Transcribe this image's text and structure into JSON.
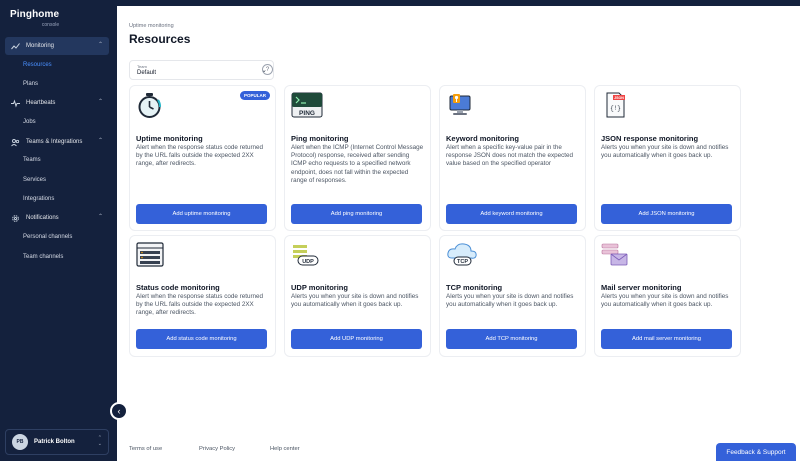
{
  "brand": {
    "name": "Pinghome",
    "sub": "console"
  },
  "sidebar": {
    "groups": [
      {
        "label": "Monitoring",
        "icon": "chart-icon"
      },
      {
        "label": "Heartbeats",
        "icon": "heartbeat-icon"
      },
      {
        "label": "Teams & Integrations",
        "icon": "team-icon"
      },
      {
        "label": "Notifications",
        "icon": "gear-icon"
      }
    ],
    "items": {
      "resources": "Resources",
      "plans": "Plans",
      "jobs": "Jobs",
      "teams": "Teams",
      "services": "Services",
      "integrations": "Integrations",
      "personal_channels": "Personal channels",
      "team_channels": "Team channels"
    }
  },
  "user": {
    "initials": "PB",
    "name": "Patrick Bolton"
  },
  "header": {
    "breadcrumb": "Uptime monitoring",
    "title": "Resources"
  },
  "team_select": {
    "label": "Team",
    "value": "Default"
  },
  "cards": [
    {
      "title": "Uptime monitoring",
      "desc": "Alert when the response status code returned by the URL falls outside the expected 2XX range, after redirects.",
      "button": "Add uptime monitoring",
      "badge": "POPULAR"
    },
    {
      "title": "Ping monitoring",
      "desc": "Alert when the ICMP (Internet Control Message Protocol) response, received after sending ICMP echo requests to a specified network endpoint, does not fall within the expected range of responses.",
      "button": "Add ping monitoring",
      "icon_text": "PING"
    },
    {
      "title": "Keyword monitoring",
      "desc": "Alert when a specific key-value pair in the response JSON does not match the expected value based on the specified operator",
      "button": "Add keyword monitoring"
    },
    {
      "title": "JSON response monitoring",
      "desc": "Alerts you when your site is down and notifies you automatically when it goes back up.",
      "button": "Add JSON monitoring",
      "icon_text": "JSON"
    },
    {
      "title": "Status code monitoring",
      "desc": "Alert when the response status code returned by the URL falls outside the expected 2XX range, after redirects.",
      "button": "Add status code monitoring"
    },
    {
      "title": "UDP monitoring",
      "desc": "Alerts you when your site is down and notifies you automatically when it goes back up.",
      "button": "Add UDP monitoring",
      "icon_text": "UDP"
    },
    {
      "title": "TCP monitoring",
      "desc": "Alerts you when your site is down and notifies you automatically when it goes back up.",
      "button": "Add TCP monitoring",
      "icon_text": "TCP"
    },
    {
      "title": "Mail server monitoring",
      "desc": "Alerts you when your site is down and notifies you automatically when it goes back up.",
      "button": "Add mail server monitoring"
    }
  ],
  "footer": {
    "terms": "Terms of use",
    "privacy": "Privacy Policy",
    "help": "Help center"
  },
  "feedback": "Feedback & Support",
  "colors": {
    "sidebar": "#14213d",
    "accent": "#3461d9",
    "active_link": "#4a90ff"
  }
}
